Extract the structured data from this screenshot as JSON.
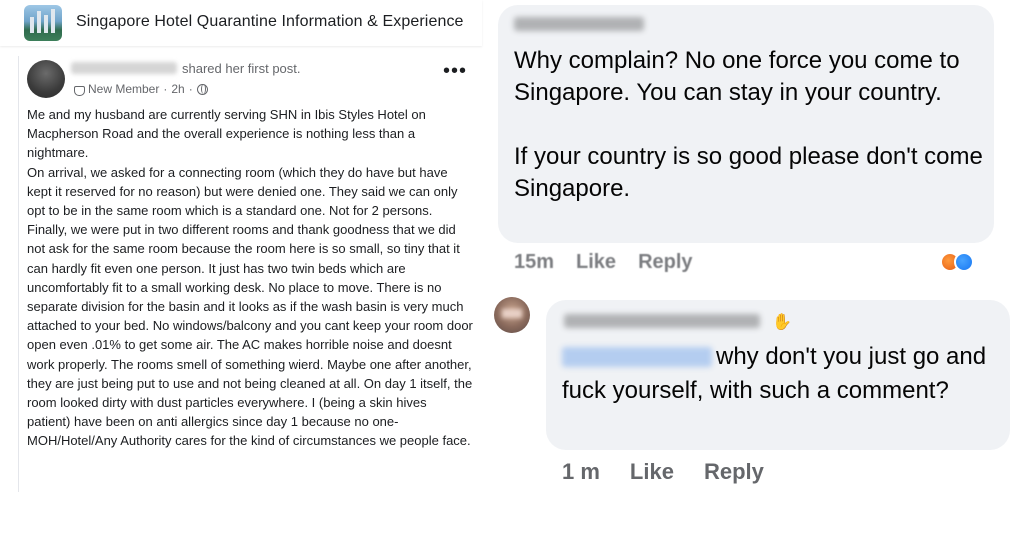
{
  "group": {
    "title": "Singapore Hotel Quarantine Information & Experience"
  },
  "post": {
    "shared_text": "shared her first post.",
    "badge": "New Member",
    "time": "2h",
    "more": "•••",
    "body": "Me and my husband are currently serving SHN in Ibis Styles Hotel on Macpherson Road and the overall experience is nothing less than a nightmare.\nOn arrival, we asked for a connecting room (which they do have but have kept it reserved for no reason) but were denied one. They said we can only opt to be in the same room which is a standard one. Not for 2 persons.\nFinally, we were put in two different rooms and thank goodness that we did not ask for the same room because the room here is so small, so tiny that it can hardly fit even one person. It just has two twin beds which are uncomfortably fit to a small working desk. No place to move. There is no separate division for the basin and it looks as if the wash basin is very much attached to your bed. No windows/balcony and you cant keep your room door open even .01% to get some air. The AC makes horrible noise and doesnt work properly. The rooms smell of something wierd. Maybe one after another, they are just being put to use and not being cleaned at all. On day 1 itself, the room looked dirty with dust particles everywhere. I (being a skin hives patient) have been on anti allergics since day 1 because no one- MOH/Hotel/Any Authority cares for the kind of circumstances we people face."
  },
  "comment1": {
    "text": "Why complain? No one force you come to Singapore. You can stay in your country.\n\nIf your country is so good please don't come Singapore.",
    "time": "15m",
    "like": "Like",
    "reply": "Reply",
    "reaction_colors": [
      "#e55b13",
      "#1877f2"
    ]
  },
  "comment2": {
    "text": "why don't you just go and fuck yourself, with such a comment?",
    "time": "1 m",
    "like": "Like",
    "reply": "Reply"
  }
}
